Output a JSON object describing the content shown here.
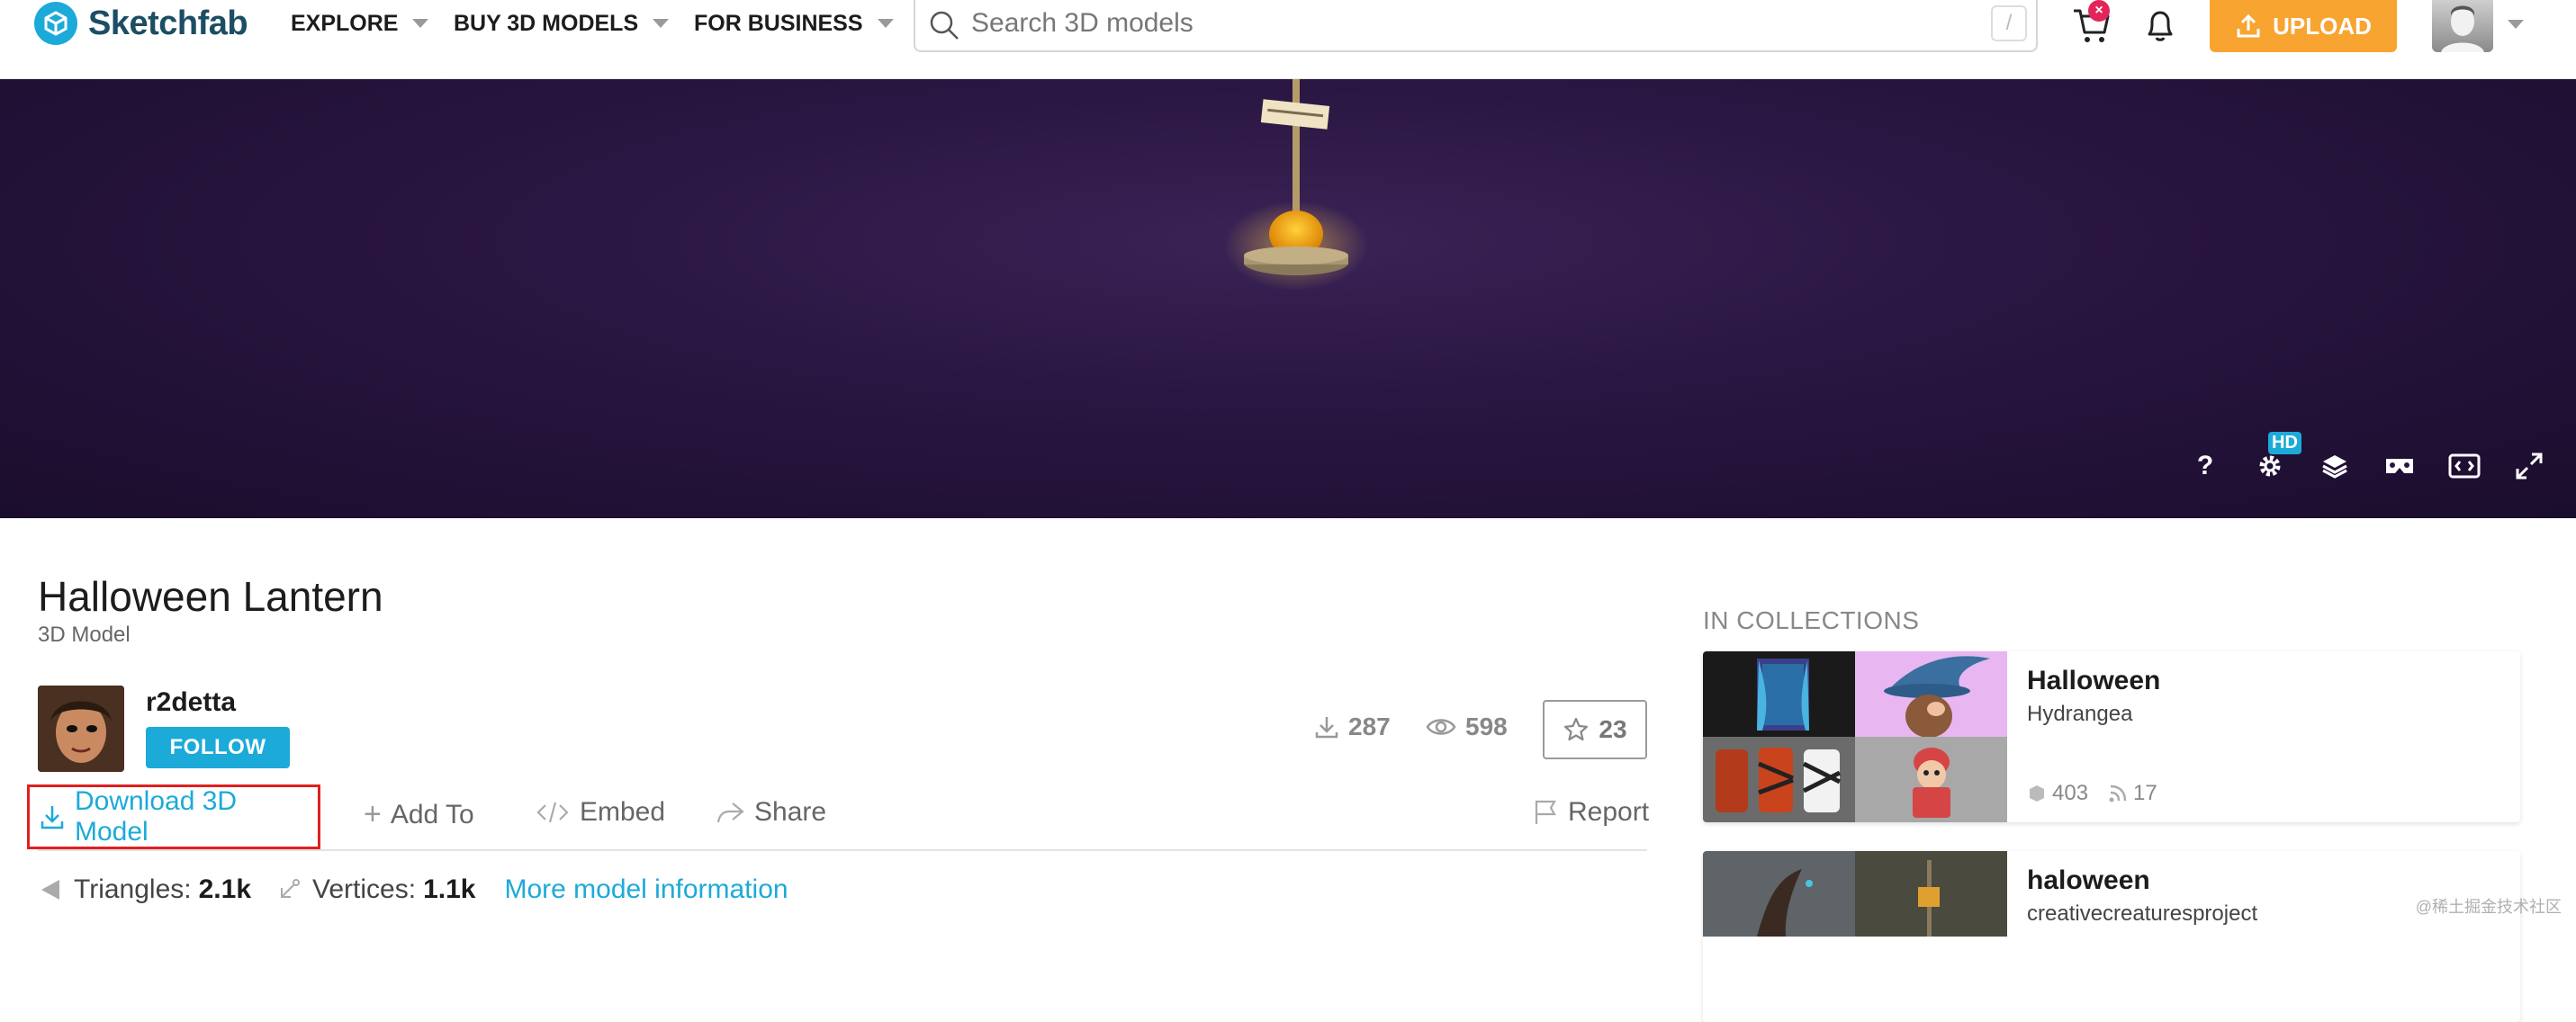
{
  "header": {
    "logo_text": "Sketchfab",
    "nav": [
      {
        "label": "EXPLORE"
      },
      {
        "label": "BUY 3D MODELS"
      },
      {
        "label": "FOR BUSINESS"
      }
    ],
    "search_placeholder": "Search 3D models",
    "search_shortcut": "/",
    "cart_badge": "×",
    "upload_label": "UPLOAD"
  },
  "viewer": {
    "hd_badge": "HD",
    "help_label": "?",
    "tools": [
      "help-icon",
      "settings-icon",
      "layers-icon",
      "vr-icon",
      "embed-view-icon",
      "fullscreen-icon"
    ]
  },
  "model": {
    "title": "Halloween Lantern",
    "subtitle": "3D Model",
    "author": "r2detta",
    "follow_label": "FOLLOW",
    "downloads": "287",
    "views": "598",
    "likes": "23"
  },
  "actions": {
    "download": "Download 3D Model",
    "add_to": "Add To",
    "embed": "Embed",
    "share": "Share",
    "report": "Report"
  },
  "info": {
    "triangles_label": "Triangles:",
    "triangles_value": "2.1k",
    "vertices_label": "Vertices:",
    "vertices_value": "1.1k",
    "more_link": "More model information"
  },
  "collections": {
    "heading": "IN COLLECTIONS",
    "items": [
      {
        "name": "Halloween",
        "owner": "Hydrangea",
        "models": "403",
        "followers": "17"
      },
      {
        "name": "haloween",
        "owner": "creativecreaturesproject"
      }
    ]
  },
  "watermark": "@稀土掘金技术社区",
  "colors": {
    "accent": "#1caad9",
    "upload": "#f8a431",
    "highlight": "#e0201f",
    "viewer_bg": "#2a1642"
  }
}
